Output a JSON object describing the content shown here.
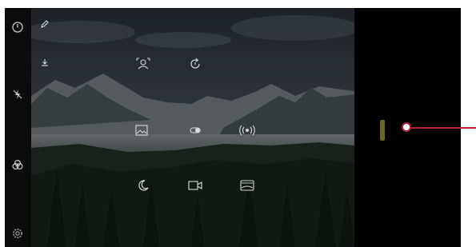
{
  "colors": {
    "device_bg": "#050505",
    "icon": "#d8d8d8",
    "accent_pill": "#7a7a2a",
    "callout": "#b81f3a"
  },
  "left_strip": {
    "icons": [
      "timer-icon",
      "flash-off-icon",
      "filters-icon",
      "settings-icon"
    ]
  },
  "preview": {
    "top_icons": [
      "edit-icon",
      "download-icon"
    ],
    "modes": [
      {
        "icon": "multi-person-icon",
        "label": ""
      },
      {
        "icon": "timer-rotate-icon",
        "label": ""
      },
      {
        "icon": "photo-icon",
        "label": ""
      },
      {
        "icon": "toggle-icon",
        "label": ""
      },
      {
        "icon": "broadcast-icon",
        "label": ""
      },
      {
        "icon": "night-moon-icon",
        "label": ""
      },
      {
        "icon": "video-icon",
        "label": ""
      },
      {
        "icon": "panorama-icon",
        "label": ""
      }
    ]
  },
  "right_panel": {
    "vertical_label": ""
  }
}
